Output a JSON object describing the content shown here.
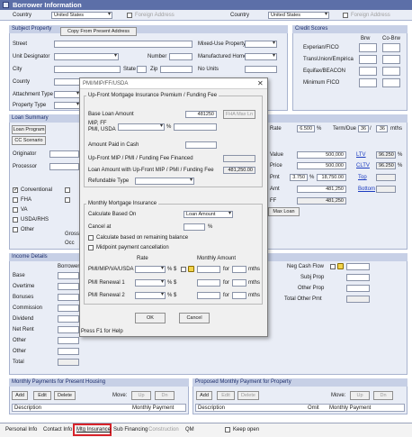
{
  "window": {
    "title": "Borrower Information"
  },
  "top_row": {
    "country_label": "Country",
    "country_value": "United States",
    "foreign_label": "Foreign Address",
    "country2_label": "Country",
    "country2_value": "United States",
    "foreign2_label": "Foreign Address"
  },
  "subject": {
    "header": "Subject Property",
    "copy_button": "Copy From Present Address",
    "street": "Street",
    "unit": "Unit Designator",
    "number": "Number",
    "city": "City",
    "state": "State",
    "zip": "Zip",
    "county": "County",
    "attachment": "Attachment Type",
    "property_type": "Property Type",
    "mixed_use": "Mixed-Use Property",
    "manufactured": "Manufactured Home",
    "no_units": "No Units"
  },
  "credit": {
    "header": "Credit Scores",
    "brw": "Brw",
    "cobrw": "Co-Brw",
    "rows": [
      "Experian/FICO",
      "TransUnion/Empirica",
      "Equifax/BEACON",
      "Minimum FICO"
    ]
  },
  "loan": {
    "header": "Loan Summary",
    "loan_program": "Loan Program",
    "cc_scenario": "CC Scenario",
    "originator": "Originator",
    "processor": "Processor",
    "types": [
      {
        "label": "Conventional",
        "checked": true
      },
      {
        "label": "FHA",
        "checked": false
      },
      {
        "label": "VA",
        "checked": false
      },
      {
        "label": "USDA/RHS",
        "checked": false
      },
      {
        "label": "Other",
        "checked": false
      }
    ],
    "gross": "Gross",
    "occ": "Occ",
    "rate_label": "Rate",
    "rate_value": "6.500",
    "rate_unit": "%",
    "term_label": "Term/Due",
    "term": "36",
    "due": "36",
    "term_unit": "mths",
    "value_label": "Value",
    "value": "500,000",
    "price_label": "Price",
    "price": "500,000",
    "pmt_label": "Pmt",
    "pmt_pct": "3.750",
    "pmt_pct_unit": "%",
    "pmt_amt": "18,750.00",
    "amt_label": "Amt",
    "amt": "481,250",
    "ff_label": "FF",
    "ff_amt": "481,250",
    "max_loan": "Max Loan",
    "ltv_label": "LTV",
    "ltv": "96.250",
    "ltv_unit": "%",
    "cltv_label": "CLTV",
    "cltv": "96.250",
    "cltv_unit": "%",
    "top_label": "Top",
    "bottom_label": "Bottom"
  },
  "income": {
    "header": "Income Details",
    "borrower": "Borrower",
    "rows": [
      "Base",
      "Overtime",
      "Bonuses",
      "Commission",
      "Dividend",
      "Net Rent",
      "Other",
      "Other",
      "Total"
    ],
    "neg_cash": "Neg Cash Flow",
    "subj_prop": "Subj Prop",
    "other_prop": "Other Prop",
    "total_other": "Total Other Pmt"
  },
  "monthly_present": {
    "header": "Monthly Payments for Present Housing",
    "add": "Add",
    "edit": "Edit",
    "delete": "Delete",
    "move": "Move:",
    "up": "Up",
    "dn": "Dn",
    "col_desc": "Description",
    "col_pmt": "Monthly Payment"
  },
  "monthly_proposed": {
    "header": "Proposed Monthly Payment for Property",
    "add": "Add",
    "edit": "Edit",
    "delete": "Delete",
    "move": "Move:",
    "up": "Up",
    "dn": "Dn",
    "col_desc": "Description",
    "col_omit": "Omit",
    "col_pmt": "Monthly Payment"
  },
  "tabs": {
    "items": [
      "Personal Info",
      "Contact Info",
      "Mtg Insurance",
      "Sub Financing",
      "Construction",
      "QM"
    ],
    "active": "Mtg Insurance",
    "keep_open": "Keep open"
  },
  "dialog": {
    "title": "PMI/MIP/FF/USDA",
    "upfront_title": "Up-Front Mortgage Insurance Premium / Funding Fee",
    "base_loan_label": "Base Loan Amount",
    "base_loan": "481250",
    "fha_max": "FHA Max Ln",
    "mip_label": "MIP, FF\nPMI, USDA",
    "mip_unit": "%",
    "paid_cash": "Amount Paid in Cash",
    "financed": "Up-Front MIP / PMI / Funding Fee Financed",
    "loan_with_label": "Loan Amount with Up-Front MIP / PMI / Funding Fee",
    "loan_with": "481,250.00",
    "refundable": "Refundable Type",
    "monthly_title": "Monthly Mortgage Insurance",
    "calc_based": "Calculate Based On",
    "calc_value": "Loan Amount",
    "cancel_at": "Cancel at",
    "cancel_unit": "%",
    "calc_remaining": "Calculate based on remaining balance",
    "midpoint": "Midpoint payment cancellation",
    "col_rate": "Rate",
    "col_monthly": "Monthly Amount",
    "mi_rows": [
      {
        "label": "PMI/MIP/VA/USDA",
        "pct": "%",
        "cur": "$",
        "for": "for",
        "mths": "mths"
      },
      {
        "label": "PMI Renewal 1",
        "pct": "%",
        "cur": "$",
        "for": "for",
        "mths": "mths"
      },
      {
        "label": "PMI Renewal 2",
        "pct": "%",
        "cur": "$",
        "for": "for",
        "mths": "mths"
      }
    ],
    "ok": "OK",
    "cancel": "Cancel",
    "help": "Press F1 for Help"
  }
}
